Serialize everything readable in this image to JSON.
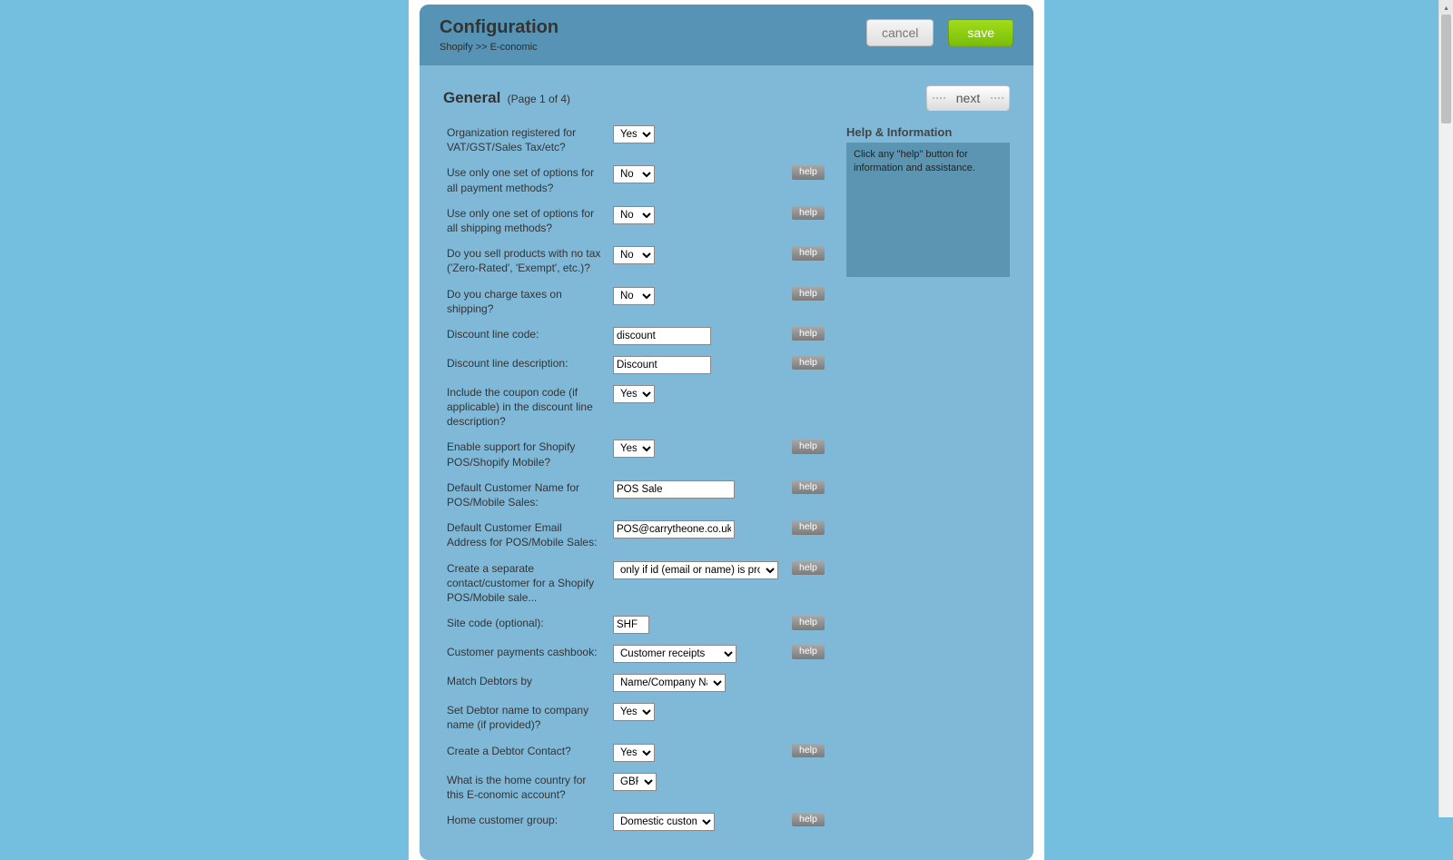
{
  "header": {
    "title": "Configuration",
    "breadcrumb": "Shopify >> E-conomic",
    "cancel_label": "cancel",
    "save_label": "save"
  },
  "section": {
    "title": "General",
    "page_indicator": "(Page 1 of 4)",
    "next_label": "next"
  },
  "help_panel": {
    "title": "Help & Information",
    "text": "Click any \"help\" button for information and assistance."
  },
  "help_button_label": "help",
  "rows": [
    {
      "id": "vat_registered",
      "label": "Organization registered for VAT/GST/Sales Tax/etc?",
      "type": "select",
      "css": "sel-yn",
      "value": "Yes",
      "help": false
    },
    {
      "id": "one_payment_options",
      "label": "Use only one set of options for all payment methods?",
      "type": "select",
      "css": "sel-yn",
      "value": "No",
      "help": true
    },
    {
      "id": "one_shipping_options",
      "label": "Use only one set of options for all shipping methods?",
      "type": "select",
      "css": "sel-yn",
      "value": "No",
      "help": true
    },
    {
      "id": "zero_rated",
      "label": "Do you sell products with no tax ('Zero-Rated', 'Exempt', etc.)?",
      "type": "select",
      "css": "sel-yn",
      "value": "No",
      "help": true
    },
    {
      "id": "tax_shipping",
      "label": "Do you charge taxes on shipping?",
      "type": "select",
      "css": "sel-yn",
      "value": "No",
      "help": true
    },
    {
      "id": "discount_code",
      "label": "Discount line code:",
      "type": "text",
      "css": "txt-med",
      "value": "discount",
      "help": true
    },
    {
      "id": "discount_desc",
      "label": "Discount line description:",
      "type": "text",
      "css": "txt-med",
      "value": "Discount",
      "help": true
    },
    {
      "id": "include_coupon",
      "label": "Include the coupon code (if applicable) in the discount line description?",
      "type": "select",
      "css": "sel-yn",
      "value": "Yes",
      "help": false
    },
    {
      "id": "pos_enable",
      "label": "Enable support for Shopify POS/Shopify Mobile?",
      "type": "select",
      "css": "sel-yn",
      "value": "Yes",
      "help": true
    },
    {
      "id": "pos_name",
      "label": "Default Customer Name for POS/Mobile Sales:",
      "type": "text",
      "css": "txt-wide",
      "value": "POS Sale",
      "help": true
    },
    {
      "id": "pos_email",
      "label": "Default Customer Email Address for POS/Mobile Sales:",
      "type": "text",
      "css": "txt-wide",
      "value": "POS@carrytheone.co.uk",
      "help": true
    },
    {
      "id": "pos_separate",
      "label": "Create a separate contact/customer for a Shopify POS/Mobile sale...",
      "type": "select",
      "css": "sel-wide",
      "value": "only if id (email or name) is provided",
      "help": true
    },
    {
      "id": "site_code",
      "label": "Site code (optional):",
      "type": "text",
      "css": "txt-short",
      "value": "SHF",
      "help": true
    },
    {
      "id": "cashbook",
      "label": "Customer payments cashbook:",
      "type": "select",
      "css": "sel-med",
      "value": "Customer receipts",
      "help": true
    },
    {
      "id": "match_debtors",
      "label": "Match Debtors by",
      "type": "select",
      "css": "sel-med2",
      "value": "Name/Company Name",
      "help": false
    },
    {
      "id": "debtor_company",
      "label": "Set Debtor name to company name (if provided)?",
      "type": "select",
      "css": "sel-yn",
      "value": "Yes",
      "help": false
    },
    {
      "id": "debtor_contact",
      "label": "Create a Debtor Contact?",
      "type": "select",
      "css": "sel-yn",
      "value": "Yes",
      "help": true
    },
    {
      "id": "home_country",
      "label": "What is the home country for this E-conomic account?",
      "type": "select",
      "css": "sel-narrow",
      "value": "GBR",
      "help": false
    },
    {
      "id": "home_cust_group",
      "label": "Home customer group:",
      "type": "select",
      "css": "sel-cust",
      "value": "Domestic customers",
      "help": true
    }
  ]
}
